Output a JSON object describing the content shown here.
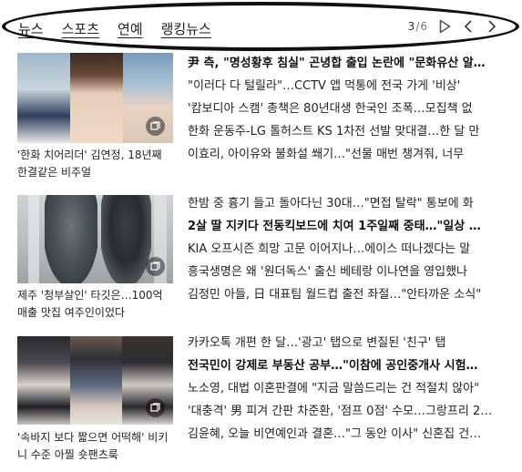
{
  "tabs": [
    "뉴스",
    "스포츠",
    "연예",
    "랭킹뉴스"
  ],
  "pager": {
    "current": "3",
    "total": "6",
    "separator": "/"
  },
  "blocks": [
    {
      "caption": "'한화 치어리더' 김연정, 18년째 한결같은 비주얼",
      "items": [
        {
          "text": "尹 측, \"명성황후 침실\" 곤녕합 출입 논란에 \"문화유산 알…",
          "bold": true
        },
        {
          "text": "\"이러다 다 털릴라\"…CCTV 앱 먹통에 전국 가게 '비상'",
          "bold": false
        },
        {
          "text": "'캄보디아 스캠' 총책은 80년대생 한국인 조폭…모집책 없",
          "bold": false
        },
        {
          "text": "한화 운동주-LG 톨허스트 KS 1차전 선발 맞대결…한 달 만",
          "bold": false
        },
        {
          "text": "이효리, 아이유와 불화설 쐐기…\"선물 매번 챙겨줘, 너무",
          "bold": false
        }
      ]
    },
    {
      "caption": "제주 '청부살인' 타깃은…100억 매출 맛집 여주인이었다",
      "items": [
        {
          "text": "한밤 중 흉기 들고 돌아다닌 30대…\"면접 탈락\" 통보에 화",
          "bold": false
        },
        {
          "text": "2살 딸 지키다 전동킥보드에 치여 1주일째 중태…\"일상 …",
          "bold": true
        },
        {
          "text": "KIA 오프시즌 희망 고문 이어지나…에이스 떠나겠다는 말",
          "bold": false
        },
        {
          "text": "흥국생명은 왜 '원더독스' 출신 베테랑 이나연을 영입했나",
          "bold": false
        },
        {
          "text": "김정민 아들, 日 대표팀 월드컵 출전 좌절…\"안타까운 소식\"",
          "bold": false
        }
      ]
    },
    {
      "caption": "'속바지 보다 짧으면 어떡해' 비키니 수준 아찔 숏팬츠룩",
      "items": [
        {
          "text": "카카오톡 개편 한 달…'광고' 탭으로 변질된 '친구' 탭",
          "bold": false
        },
        {
          "text": "전국민이 강제로 부동산 공부…\"이참에 공인중개사 시험…",
          "bold": true
        },
        {
          "text": "노소영, 대법 이혼판결에 \"지금 말씀드리는 건 적절치 않아\"",
          "bold": false
        },
        {
          "text": "'대충격' 男 피겨 간판 차준환, '점프 0점' 수모…그랑프리 2…",
          "bold": false
        },
        {
          "text": "김윤혜, 오늘 비연예인과 결혼…\"그 동안 이사\" 신혼집 건…",
          "bold": false
        }
      ]
    }
  ]
}
